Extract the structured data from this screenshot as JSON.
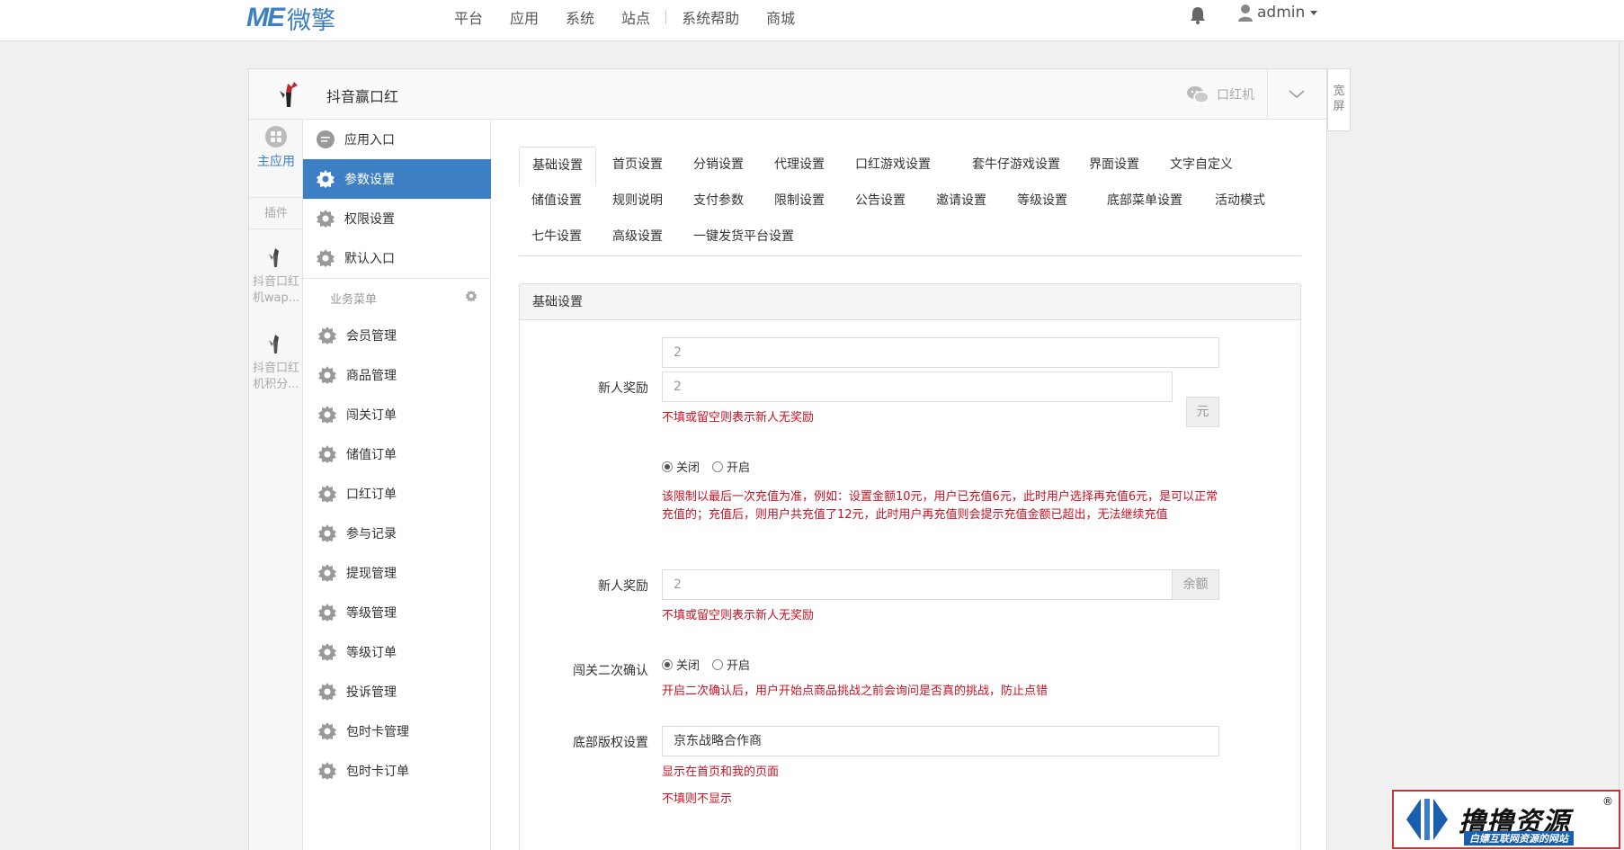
{
  "topbar": {
    "logo_mark": "ME",
    "logo_name": "微擎",
    "nav": [
      "平台",
      "应用",
      "系统",
      "站点",
      "系统帮助",
      "商城"
    ],
    "user": "admin"
  },
  "panel": {
    "app_title": "抖音赢口红",
    "head_right_label": "口红机",
    "wide_label": "宽屏"
  },
  "iconcol": {
    "main_app": "主应用",
    "plugin": "插件",
    "plugins": [
      "抖音口红机wap...",
      "抖音口红机积分..."
    ]
  },
  "menu": {
    "top_items": [
      "应用入口",
      "参数设置",
      "权限设置",
      "默认入口"
    ],
    "active_index": 1,
    "section": "业务菜单",
    "business_items": [
      "会员管理",
      "商品管理",
      "闯关订单",
      "储值订单",
      "口红订单",
      "参与记录",
      "提现管理",
      "等级管理",
      "等级订单",
      "投诉管理",
      "包时卡管理",
      "包时卡订单"
    ]
  },
  "tabs": {
    "row1": [
      "基础设置",
      "首页设置",
      "分销设置",
      "代理设置",
      "口红游戏设置",
      "套牛仔游戏设置",
      "界面设置",
      "文字自定义"
    ],
    "row2": [
      "储值设置",
      "规则说明",
      "支付参数",
      "限制设置",
      "公告设置",
      "邀请设置",
      "等级设置",
      "底部菜单设置",
      "活动模式"
    ],
    "row3": [
      "七牛设置",
      "高级设置",
      "一键发货平台设置"
    ]
  },
  "form": {
    "title": "基础设置",
    "input_top_value": "2",
    "newbie_label": "新人奖励",
    "newbie_value": "2",
    "newbie_addon": "元",
    "newbie_hint": "不填或留空则表示新人无奖励",
    "radio_off": "关闭",
    "radio_on": "开启",
    "limit_hint": "该限制以最后一次充值为准，例如：设置金额10元，用户已充值6元，此时用户选择再充值6元，是可以正常充值的；充值后，则用户共充值了12元，此时用户再充值则会提示充值金额已超出，无法继续充值",
    "newbie2_label": "新人奖励",
    "newbie2_value": "2",
    "newbie2_addon": "余额",
    "newbie2_hint": "不填或留空则表示新人无奖励",
    "confirm_label": "闯关二次确认",
    "confirm_hint": "开启二次确认后，用户开始点商品挑战之前会询问是否真的挑战，防止点错",
    "copyright_label": "底部版权设置",
    "copyright_value": "京东战略合作商",
    "copyright_hint1": "显示在首页和我的页面",
    "copyright_hint2": "不填则不显示"
  },
  "watermark": {
    "title": "撸撸资源",
    "sub": "白嫖互联网资源的网站",
    "reg": "®"
  },
  "colors": {
    "accent": "#3d7fc4",
    "hint_red": "#cc1122"
  }
}
